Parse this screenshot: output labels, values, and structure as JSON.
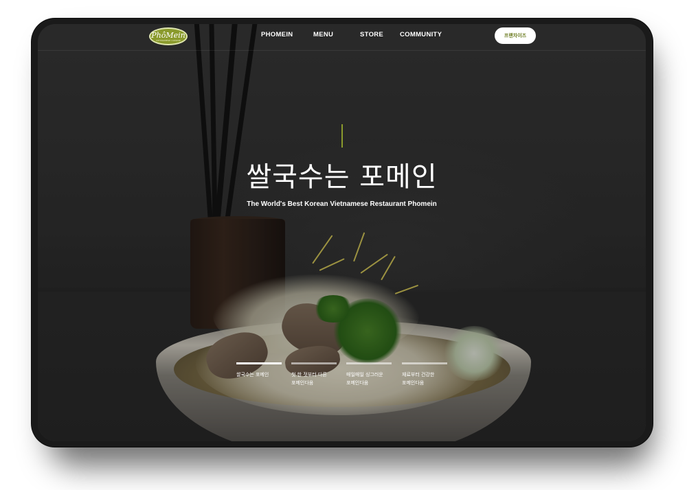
{
  "header": {
    "logo_text": "PhôMein",
    "logo_subtext": "VIETNAMESE CUISINE",
    "nav": [
      {
        "label": "PHOMEIN"
      },
      {
        "label": "MENU"
      },
      {
        "label": "STORE"
      },
      {
        "label": "COMMUNITY"
      }
    ],
    "franchise_label": "프랜차이즈"
  },
  "hero": {
    "title": "쌀국수는 포메인",
    "subtitle": "The World's Best Korean Vietnamese Restaurant Phomein"
  },
  "features": [
    {
      "label": "쌀국수는 포메인",
      "active": true
    },
    {
      "label": "첫 한 젓부터 다른\n포메인다움",
      "active": false
    },
    {
      "label": "매일매일 싱그러운\n포메인다움",
      "active": false
    },
    {
      "label": "재료부터 건강한\n포메인다움",
      "active": false
    }
  ],
  "colors": {
    "accent": "#8a9a2c",
    "background": "#333333",
    "device_frame": "#1a1a1a"
  }
}
